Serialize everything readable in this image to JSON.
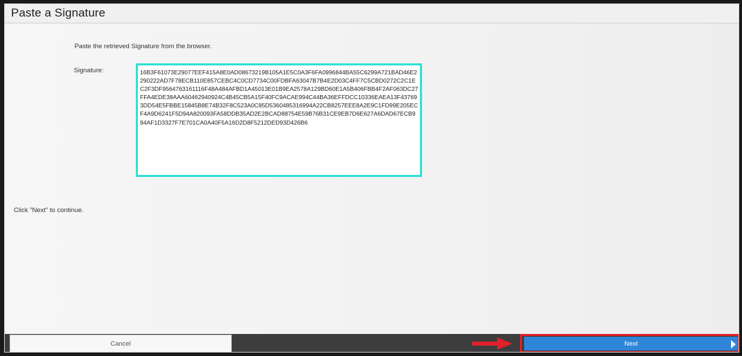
{
  "window": {
    "title": "Paste a Signature"
  },
  "main": {
    "instruction": "Paste the retrieved Signature from the browser.",
    "signature_label": "Signature:",
    "signature_value": "16B3F61073E29077EEF415A8E0AD08673219B105A1E5C0A3F6FA0996844BA55C6299A721BAD46E2290222AD7F78ECB110E857CEBC4C0CD7734C00FDBFA63047B7B4E2D03C4FF7C5CBD0272C2C1EC2F3DF9564763161116F48A484AFBD1A45013E01B9EA2578A129BD60E1A5B406FBB4F2AF063DC27FFA4EDE38AAA60462940924C4B45CB5A15F40FC9ACAE994C44BA36EFFDCC10336EAEA13F437693DD54E5FBBE15845B8E74B32F8C523A0C85D5360485316994A22CB8257EEE8A2E9C1FD99E205ECF4A9D6241F5D94A820093FA58DDB35AD2E2BCAD88754E59B76B31CE9EB7D6E627A6DAD67ECB994AF1D3327F7E701CA0A40F5A16D2D8F5212DED93D426B6",
    "continue_text": "Click \"Next\" to continue."
  },
  "footer": {
    "cancel_label": "Cancel",
    "next_label": "Next"
  },
  "colors": {
    "signature_border": "#2fe0d4",
    "next_button": "#2f86d8",
    "highlight_red": "#e0202a"
  },
  "icons": {
    "annotation_arrow": "red-right-arrow",
    "next_icon": "triangle-right"
  }
}
